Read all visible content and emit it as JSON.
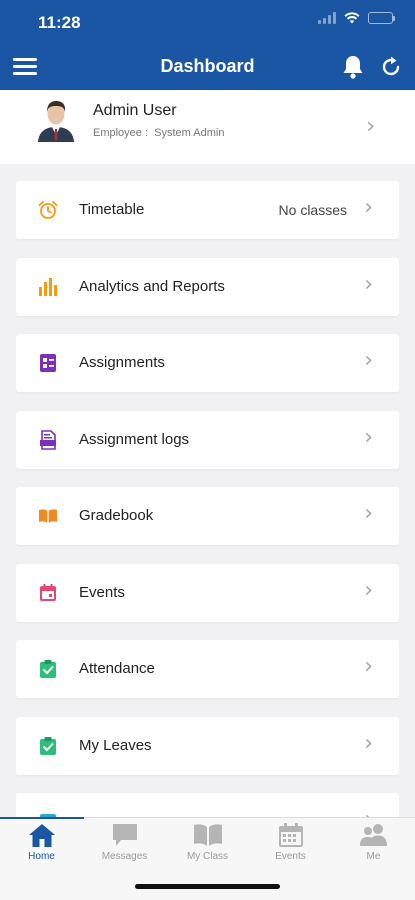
{
  "status_bar": {
    "time": "11:28"
  },
  "header": {
    "title": "Dashboard"
  },
  "profile": {
    "name": "Admin User",
    "subtitle": "Employee :  System Admin"
  },
  "menu": [
    {
      "label": "Timetable",
      "value": "No classes",
      "icon": "alarm-clock-icon",
      "color": "#f39c12"
    },
    {
      "label": "Analytics and Reports",
      "icon": "bar-chart-icon",
      "color": "#f39c12"
    },
    {
      "label": "Assignments",
      "icon": "assignment-icon",
      "color": "#7b2fbe"
    },
    {
      "label": "Assignment logs",
      "icon": "assignment-log-icon",
      "color": "#7b2fbe"
    },
    {
      "label": "Gradebook",
      "icon": "open-book-icon",
      "color": "#f08a24"
    },
    {
      "label": "Events",
      "icon": "calendar-icon",
      "color": "#e5466f"
    },
    {
      "label": "Attendance",
      "icon": "clipboard-check-icon",
      "color": "#2fbd7a"
    },
    {
      "label": "My Leaves",
      "icon": "clipboard-check-icon",
      "color": "#2fbd7a"
    },
    {
      "label": "",
      "icon": "partial-icon",
      "color": "#2ba6d8"
    }
  ],
  "tabs": [
    {
      "label": "Home",
      "icon": "home-icon",
      "active": true
    },
    {
      "label": "Messages",
      "icon": "chat-bubble-icon"
    },
    {
      "label": "My Class",
      "icon": "book-icon"
    },
    {
      "label": "Events",
      "icon": "calendar-icon"
    },
    {
      "label": "Me",
      "icon": "people-icon"
    }
  ],
  "colors": {
    "primary": "#1b56a4",
    "background": "#f1f1f3",
    "tab_inactive": "#9a9a9a"
  }
}
